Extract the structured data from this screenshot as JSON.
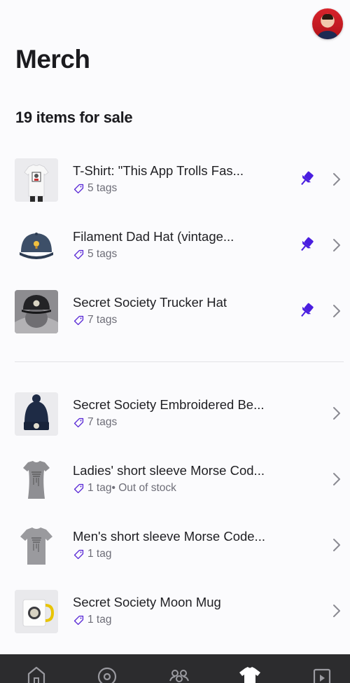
{
  "header": {
    "title": "Merch"
  },
  "summary": {
    "count_label": "19 items for sale"
  },
  "pinned_items": [
    {
      "name": "T-Shirt: \"This App Trolls Fas...",
      "tags": "5 tags",
      "status": ""
    },
    {
      "name": "Filament Dad Hat (vintage...",
      "tags": "5 tags",
      "status": ""
    },
    {
      "name": "Secret Society Trucker Hat",
      "tags": "7 tags",
      "status": ""
    }
  ],
  "items": [
    {
      "name": "Secret Society Embroidered Be...",
      "tags": "7 tags",
      "status": ""
    },
    {
      "name": "Ladies' short sleeve Morse Cod...",
      "tags": "1 tag",
      "status": " • Out of stock"
    },
    {
      "name": "Men's short sleeve Morse Code...",
      "tags": "1 tag",
      "status": ""
    },
    {
      "name": "Secret Society Moon Mug",
      "tags": "1 tag",
      "status": ""
    }
  ],
  "tabbar": {
    "items": [
      "home-tab",
      "discover-tab",
      "community-tab",
      "merch-tab",
      "media-tab"
    ]
  },
  "colors": {
    "accent": "#4a1ee0",
    "tag_icon": "#5b2bd6",
    "background": "#fbfbfd",
    "tabbar": "#2c2c2e"
  }
}
